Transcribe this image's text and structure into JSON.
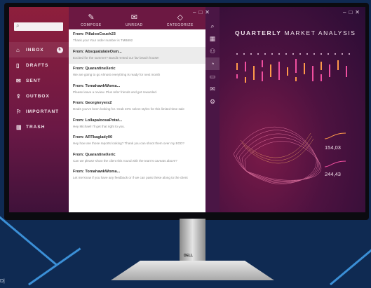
{
  "sidebar": {
    "items": [
      {
        "label": "INBOX",
        "icon": "inbox-icon",
        "badge": "6"
      },
      {
        "label": "DRAFTS",
        "icon": "draft-icon"
      },
      {
        "label": "SENT",
        "icon": "sent-icon"
      },
      {
        "label": "OUTBOX",
        "icon": "outbox-icon"
      },
      {
        "label": "IMPORTANT",
        "icon": "flag-icon"
      },
      {
        "label": "TRASH",
        "icon": "trash-icon"
      }
    ]
  },
  "toolbar": {
    "compose": "COMPOSE",
    "unread": "UNREAD",
    "categorize": "CATEGORIZE"
  },
  "messages": [
    {
      "from": "From: PillalooCouch23",
      "preview": "Thank you! Your order number is TMB892"
    },
    {
      "from": "From: AbsquatulateOsm...",
      "preview": "Excited for the summer? Bandit rented our fav beach house!"
    },
    {
      "from": "From: QuarantineXeric",
      "preview": "We are going to go Almost everything is ready for next month"
    },
    {
      "from": "From: TomahawkWoma...",
      "preview": "Please leave a review. Plus refer friends and get rewarded."
    },
    {
      "from": "From: Georgieryers2",
      "preview": "Deals you've been looking for. Grab 40% select styles for this limited-time sale"
    },
    {
      "from": "From: LollapaloosaPotat...",
      "preview": "Hey Michael! I'll get that right to you."
    },
    {
      "from": "From: ARTbaglady00",
      "preview": "Hey how are those reports looking? Thank you can shoot them over my EOD?"
    },
    {
      "from": "From: QuarantineXeric",
      "preview": "Can we please show the client this round with the team's caveats above?"
    },
    {
      "from": "From: TomahawkWoma...",
      "preview": "Let me know if you have any feedback or if we can pass these along to the client"
    }
  ],
  "analysis": {
    "title_bold": "QUARTERLY",
    "title_rest": " MARKET ANALYSIS",
    "metric1": "154,03",
    "metric2": "244,43"
  },
  "monitor": {
    "brand": "DELL"
  },
  "corner_text": "D|",
  "colors": {
    "sidebar_top": "#8e1f3c",
    "panel_dark": "#2a0d35",
    "accent_orange": "#ff9a4a",
    "accent_pink": "#f14fa0",
    "background": "#0f2a52"
  }
}
